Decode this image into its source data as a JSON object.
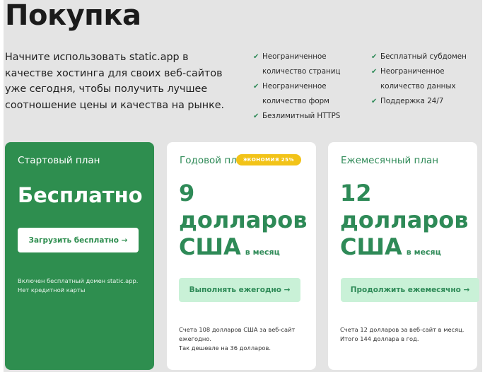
{
  "page": {
    "title": "Покупка",
    "intro": "Начните использовать static.app в качестве хостинга для своих веб-сайтов уже сегодня, чтобы получить лучшее соотношение цены и качества на рынке."
  },
  "features": {
    "col1": [
      {
        "line1": "Неограниченное",
        "line2": "количество страниц"
      },
      {
        "line1": "Неограниченное",
        "line2": "количество форм"
      },
      {
        "line1": "Безлимитный HTTPS",
        "line2": ""
      }
    ],
    "col2": [
      {
        "line1": "Бесплатный субдомен",
        "line2": ""
      },
      {
        "line1": "Неограниченное",
        "line2": "количество данных"
      },
      {
        "line1": "Поддержка 24/7",
        "line2": ""
      }
    ],
    "check_icon": "checkmark-icon"
  },
  "plans": {
    "free": {
      "name": "Стартовый план",
      "price": "Бесплатно",
      "button": "Загрузить бесплатно →",
      "note1": "Включен бесплатный домен static.app.",
      "note2": "Нет кредитной карты"
    },
    "annual": {
      "name": "Годовой пла",
      "badge": "ЭКОНОМИЯ 25%",
      "price_line1": "9",
      "price_line2": "долларов",
      "price_line3": "США",
      "per": "в месяц",
      "button": "Выполнять ежегодно →",
      "note1": "Счета 108 долларов США за веб-сайт",
      "note2": "ежегодно.",
      "note3": "Так дешевле на 36 долларов."
    },
    "monthly": {
      "name": "Ежемесячный план",
      "price_line1": "12",
      "price_line2": "долларов",
      "price_line3": "США",
      "per": "в месяц",
      "button": "Продолжить ежемесячно →",
      "note1": "Счета 12 долларов за веб-сайт в месяц.",
      "note2": "Итого 144 доллара в год."
    }
  },
  "colors": {
    "brand_green": "#2e8e4f",
    "accent_green_light": "#c9f1d7",
    "badge_yellow": "#f2c318",
    "background": "#e4e4e4"
  }
}
